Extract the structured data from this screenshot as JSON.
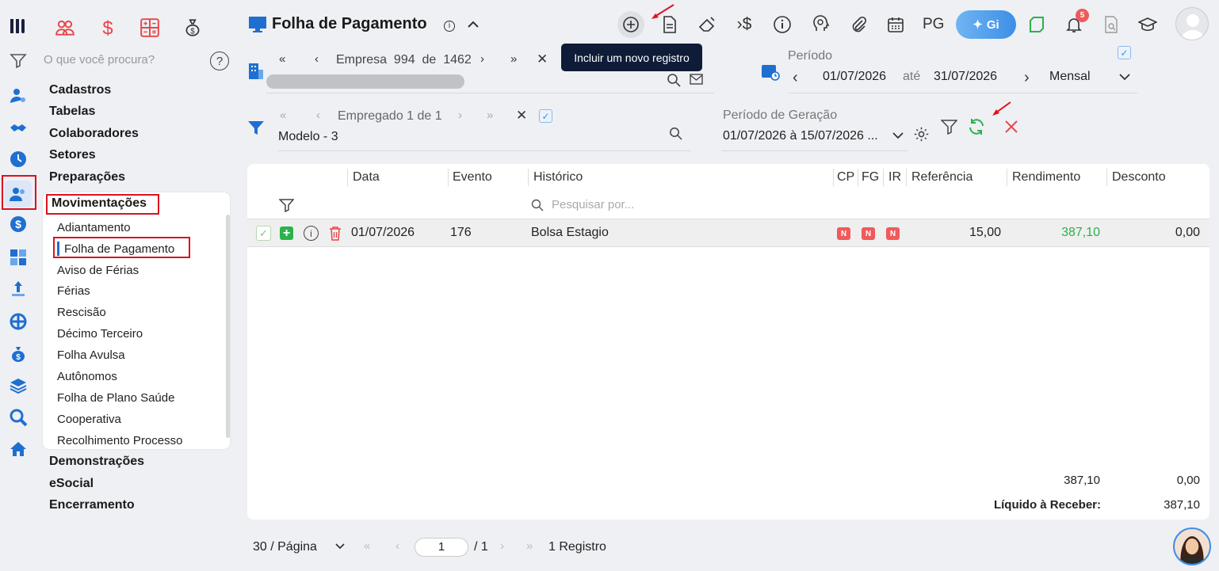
{
  "rail": {
    "icons": [
      "logo-icon",
      "filter-icon",
      "user-gear-icon",
      "handshake-icon",
      "clock-icon",
      "users-icon",
      "dollar-circle-icon",
      "calculator-icon",
      "chart-arrow-icon",
      "network-icon",
      "money-bag-icon",
      "layers-icon",
      "search-icon",
      "home-icon"
    ]
  },
  "nav": {
    "search_placeholder": "O que você procura?",
    "sections_top": [
      "Cadastros",
      "Tabelas",
      "Colaboradores",
      "Setores",
      "Preparações",
      "Movimentações"
    ],
    "sub_items": [
      "Adiantamento",
      "Folha de Pagamento",
      "Aviso de Férias",
      "Férias",
      "Rescisão",
      "Décimo Terceiro",
      "Folha Avulsa",
      "Autônomos",
      "Folha de Plano Saúde",
      "Cooperativa",
      "Recolhimento Processo"
    ],
    "sections_bottom": [
      "Demonstrações",
      "eSocial",
      "Encerramento"
    ]
  },
  "header": {
    "title": "Folha de Pagamento",
    "tooltip": "Incluir um novo registro",
    "pg_label": "PG",
    "gi_label": "Gi",
    "notif_count": "5"
  },
  "empresa": {
    "label": "Empresa",
    "current": "994",
    "of": "de",
    "total": "1462"
  },
  "periodo": {
    "label": "Período",
    "start": "01/07/2026",
    "until": "até",
    "end": "31/07/2026",
    "mode": "Mensal"
  },
  "empregado": {
    "nav_label": "Empregado 1 de 1",
    "value": "Modelo - 3"
  },
  "geracao": {
    "label": "Período de Geração",
    "value": "01/07/2026 à 15/07/2026 ..."
  },
  "grid": {
    "columns": [
      "Data",
      "Evento",
      "Histórico",
      "CP",
      "FG",
      "IR",
      "Referência",
      "Rendimento",
      "Desconto"
    ],
    "search_placeholder": "Pesquisar por...",
    "rows": [
      {
        "data": "01/07/2026",
        "evento": "176",
        "historico": "Bolsa Estagio",
        "cp": "N",
        "fg": "N",
        "ir": "N",
        "referencia": "15,00",
        "rendimento": "387,10",
        "desconto": "0,00"
      }
    ],
    "total_rendimento": "387,10",
    "total_desconto": "0,00",
    "liquido_label": "Líquido à Receber:",
    "liquido_value": "387,10"
  },
  "pagination": {
    "per_page": "30 / Página",
    "page": "1",
    "of_pages": "/ 1",
    "records": "1 Registro"
  },
  "colors": {
    "accent": "#1f6fd0",
    "green": "#2bb24c",
    "red": "#e8454a"
  }
}
